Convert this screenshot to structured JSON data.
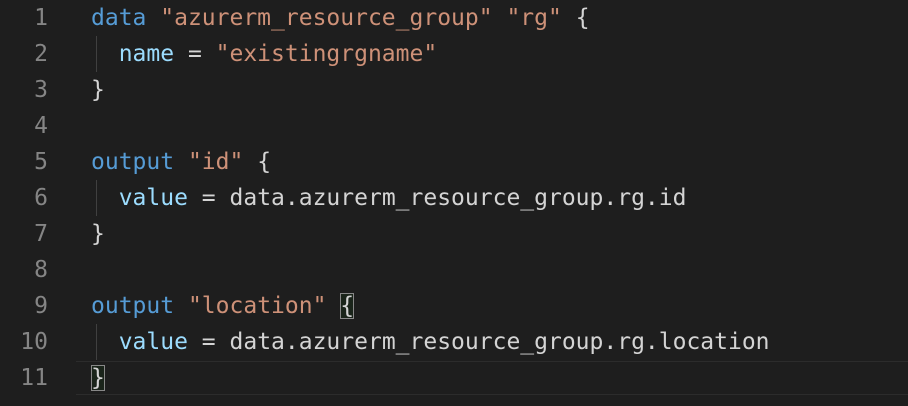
{
  "editor": {
    "line_numbers": [
      "1",
      "2",
      "3",
      "4",
      "5",
      "6",
      "7",
      "8",
      "9",
      "10",
      "11"
    ],
    "lines": [
      [
        {
          "t": "data",
          "c": "kw"
        },
        {
          "t": " ",
          "c": "plain"
        },
        {
          "t": "\"azurerm_resource_group\"",
          "c": "str"
        },
        {
          "t": " ",
          "c": "plain"
        },
        {
          "t": "\"rg\"",
          "c": "str"
        },
        {
          "t": " {",
          "c": "plain"
        }
      ],
      [
        {
          "t": "  ",
          "c": "plain"
        },
        {
          "t": "name",
          "c": "attr"
        },
        {
          "t": " = ",
          "c": "plain"
        },
        {
          "t": "\"existingrgname\"",
          "c": "str"
        }
      ],
      [
        {
          "t": "}",
          "c": "plain"
        }
      ],
      [],
      [
        {
          "t": "output",
          "c": "kw"
        },
        {
          "t": " ",
          "c": "plain"
        },
        {
          "t": "\"id\"",
          "c": "str"
        },
        {
          "t": " {",
          "c": "plain"
        }
      ],
      [
        {
          "t": "  ",
          "c": "plain"
        },
        {
          "t": "value",
          "c": "attr"
        },
        {
          "t": " = data.azurerm_resource_group.rg.id",
          "c": "plain"
        }
      ],
      [
        {
          "t": "}",
          "c": "plain"
        }
      ],
      [],
      [
        {
          "t": "output",
          "c": "kw"
        },
        {
          "t": " ",
          "c": "plain"
        },
        {
          "t": "\"location\"",
          "c": "str"
        },
        {
          "t": " ",
          "c": "plain"
        },
        {
          "t": "{",
          "c": "plain",
          "match": true
        }
      ],
      [
        {
          "t": "  ",
          "c": "plain"
        },
        {
          "t": "value",
          "c": "attr"
        },
        {
          "t": " = data.azurerm_resource_group.rg.location",
          "c": "plain"
        }
      ],
      [
        {
          "t": "}",
          "c": "plain",
          "match": true
        }
      ]
    ]
  }
}
